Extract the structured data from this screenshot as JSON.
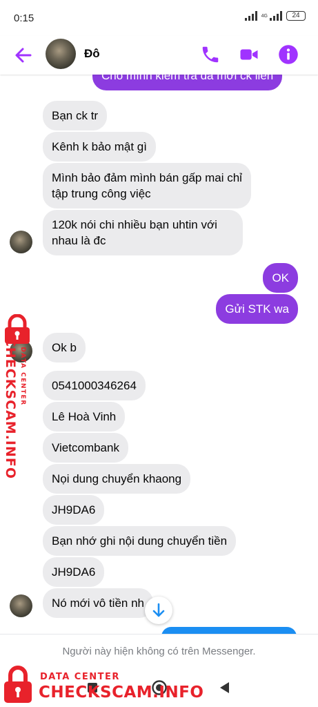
{
  "status_bar": {
    "time": "0:15",
    "network": "4G",
    "battery": "24"
  },
  "header": {
    "contact_name": "Đô",
    "accent_color": "#a033ff"
  },
  "messages": {
    "m0": "Cho mình kiểm tra đã mới ck liền",
    "m1": "Bạn ck tr",
    "m2": "Kênh k bảo mật gì",
    "m3": "Mình bảo đảm mình bán gấp mai chỉ tập trung công việc",
    "m4": "120k nói chi nhiều bạn uhtin với nhau là đc",
    "m5": "OK",
    "m6": "Gửi STK wa",
    "m7": "Ok b",
    "m8": "0541000346264",
    "m9": "Lê Hoà Vinh",
    "m10": "Vietcombank",
    "m11": "Nọi dung chuyển khaong",
    "m12": "JH9DA6",
    "m13": "Bạn nhớ ghi nội dung chuyển tiền",
    "m14": "JH9DA6",
    "m15": "Nó mới vô tiền nh"
  },
  "notice": "Người này hiện không có trên Messenger.",
  "watermark": {
    "small": "DATA CENTER",
    "big": "CHECKSCAM.INFO",
    "color": "#e8222b"
  },
  "icons": [
    "back-arrow-icon",
    "phone-icon",
    "video-camera-icon",
    "info-icon",
    "arrow-down-icon",
    "home-icon",
    "square-icon",
    "back-triangle-icon",
    "lock-icon"
  ]
}
